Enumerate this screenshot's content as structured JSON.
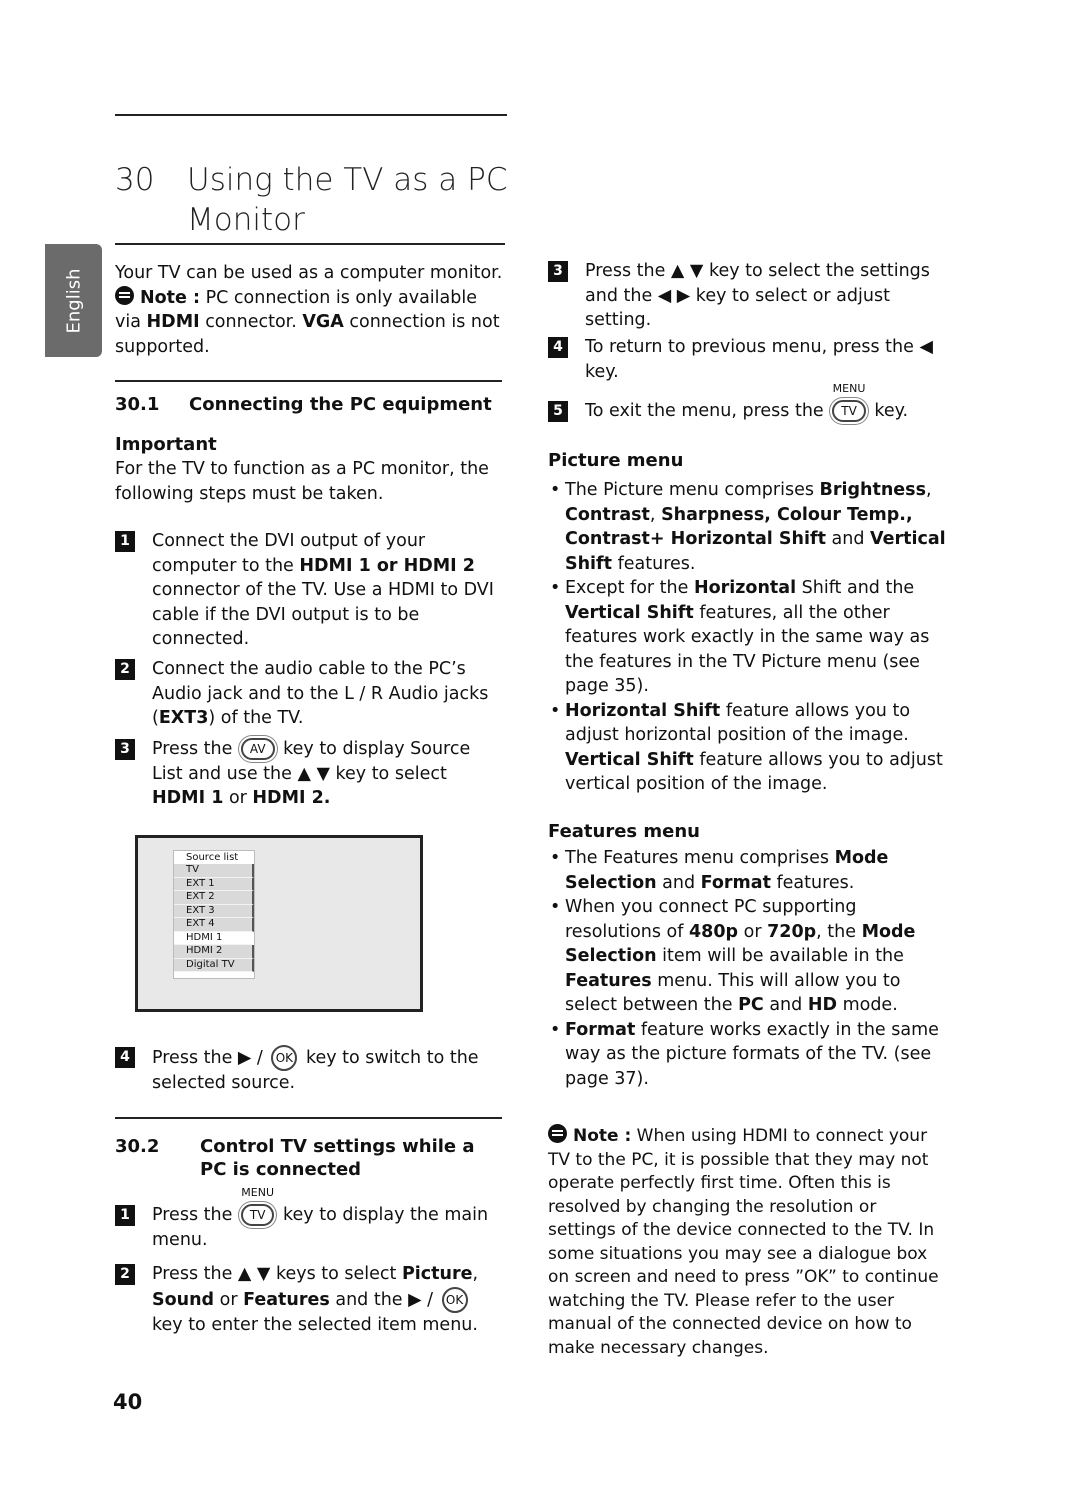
{
  "side_tab": {
    "language": "English"
  },
  "chapter": {
    "number": "30",
    "title_line1": "Using the TV as a PC",
    "title_line2": "Monitor"
  },
  "intro": {
    "text": "Your TV can be used as a computer monitor.",
    "note_label": "Note :",
    "note_text_1": " PC connection is only available via ",
    "note_bold_1": "HDMI",
    "note_text_2": " connector. ",
    "note_bold_2": "VGA",
    "note_text_3": " connection is not supported."
  },
  "section1": {
    "number": "30.1",
    "title": "Connecting the PC equipment",
    "important_label": "Important",
    "important_text": "For the TV to function as a PC monitor, the following steps must be taken.",
    "steps": [
      {
        "badge": "1",
        "t1": "Connect the DVI output of your computer to the ",
        "b1": "HDMI 1 or HDMI 2",
        "t2": " connector of the TV. Use a HDMI to DVI cable if the DVI output is to be connected."
      },
      {
        "badge": "2",
        "t1": "Connect the audio cable to the PC’s Audio jack and to the L / R Audio jacks (",
        "b1": "EXT3",
        "t2": ") of the TV."
      },
      {
        "badge": "3",
        "t1": "Press the ",
        "key": "AV",
        "t2": " key to display Source List  and use the ▲ ▼ key to select ",
        "b1": "HDMI 1",
        "t3": " or ",
        "b2": "HDMI 2."
      },
      {
        "badge": "4",
        "t1": "Press the ▶ / ",
        "key": "OK",
        "t2": " key to switch to the selected source."
      }
    ],
    "source_list": {
      "header": "Source list",
      "items": [
        "TV",
        "EXT 1",
        "EXT 2",
        "EXT 3",
        "EXT 4",
        "HDMI 1",
        "HDMI 2",
        "Digital TV"
      ],
      "selected": "HDMI 1"
    }
  },
  "section2": {
    "number": "30.2",
    "title_line1": "Control TV settings while a",
    "title_line2": "PC is connected",
    "steps": [
      {
        "badge": "1",
        "t1": "Press the ",
        "key_top": "MENU",
        "key": "TV",
        "t2": " key to display the main menu."
      },
      {
        "badge": "2",
        "t1": "Press the  ▲ ▼ keys to select ",
        "b1": "Picture",
        "t2": ", ",
        "b2": "Sound",
        "t3": " or ",
        "b3": "Features",
        "t4": " and the ▶ / ",
        "key": "OK",
        "t5": " key to enter the selected item menu."
      },
      {
        "badge": "3",
        "t1": "Press the ▲ ▼ key to select the settings and the ◀  ▶ key to select or adjust setting."
      },
      {
        "badge": "4",
        "t1": "To return to previous menu, press the ◀ key."
      },
      {
        "badge": "5",
        "t1": "To exit the menu, press the ",
        "key_top": "MENU",
        "key": "TV",
        "t2": " key."
      }
    ]
  },
  "picture_menu": {
    "title": "Picture menu",
    "b1_t1": "The Picture menu comprises ",
    "b1_bold1": "Brightness",
    "b1_t2": ", ",
    "b1_bold2": "Contrast",
    "b1_t3": ", ",
    "b1_bold3": "Sharpness, Colour Temp., Contrast+ Horizontal Shift",
    "b1_t4": " and ",
    "b1_bold4": "Vertical Shift",
    "b1_t5": " features.",
    "b2_t1": "Except for the ",
    "b2_bold1": "Horizontal",
    "b2_t2": " Shift and the ",
    "b2_bold2": "Vertical Shift",
    "b2_t3": " features, all the other features work exactly in the same way as the features in the TV Picture menu (see page 35).",
    "b3_bold1": "Horizontal Shift",
    "b3_t1": " feature allows you to adjust horizontal position of the image. ",
    "b3_bold2": "Vertical Shift",
    "b3_t2": " feature allows you to adjust vertical position of the image."
  },
  "features_menu": {
    "title": "Features menu",
    "b1_t1": "The Features menu comprises ",
    "b1_bold1": "Mode Selection",
    "b1_t2": " and ",
    "b1_bold2": "Format",
    "b1_t3": " features.",
    "b2_t1": "When you connect PC supporting resolutions of ",
    "b2_bold1": "480p",
    "b2_t2": " or ",
    "b2_bold2": "720p",
    "b2_t3": ", the ",
    "b2_bold3": "Mode Selection",
    "b2_t4": " item will be available in the ",
    "b2_bold4": "Features",
    "b2_t5": " menu. This will allow you to select between the ",
    "b2_bold5": "PC",
    "b2_t6": " and ",
    "b2_bold6": "HD",
    "b2_t7": " mode.",
    "b3_bold1": "Format",
    "b3_t1": " feature works exactly in the same way as the picture formats of the TV. (see page 37)."
  },
  "note2": {
    "label": "Note :",
    "text": " When using HDMI to connect your TV to the PC, it is possible that they may not operate perfectly first time. Often this is resolved by changing the resolution or settings of the device connected to the TV.  In some situations you may see a dialogue box on screen and need to press ”OK” to continue watching the TV.  Please refer to the user manual of the connected device on how to make necessary changes."
  },
  "page_number": "40"
}
